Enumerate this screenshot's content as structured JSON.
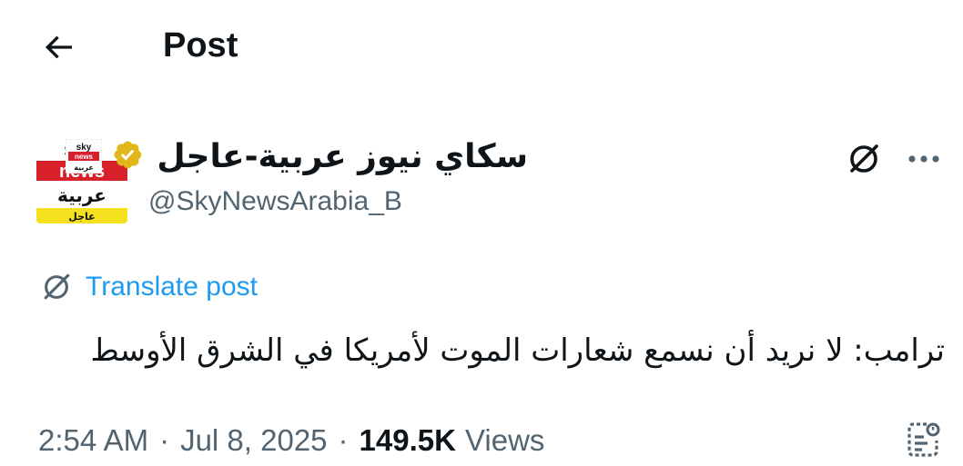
{
  "header": {
    "title": "Post",
    "back_icon": "arrow-left-icon"
  },
  "author": {
    "display_name": "سكاي نيوز عربية-عاجل",
    "handle": "@SkyNewsArabia_B",
    "verified_color": "#e2b719",
    "avatar": {
      "line1": "sky",
      "line2": "news",
      "line3": "عربية",
      "line4": "عاجل",
      "red": "#d8202a",
      "yellow": "#f4e01c"
    }
  },
  "actions": {
    "grok_icon": "grok-icon",
    "more_icon": "more-horizontal-icon"
  },
  "translate": {
    "label": "Translate post"
  },
  "post": {
    "text": "ترامب: لا نريد أن نسمع شعارات الموت لأمريكا في الشرق الأوسط"
  },
  "meta": {
    "time": "2:54 AM",
    "separator": "·",
    "date": "Jul 8, 2025",
    "views_count": "149.5K",
    "views_label": "Views"
  },
  "colors": {
    "text_primary": "#0f1419",
    "text_secondary": "#536471",
    "link": "#1d9bf0"
  }
}
